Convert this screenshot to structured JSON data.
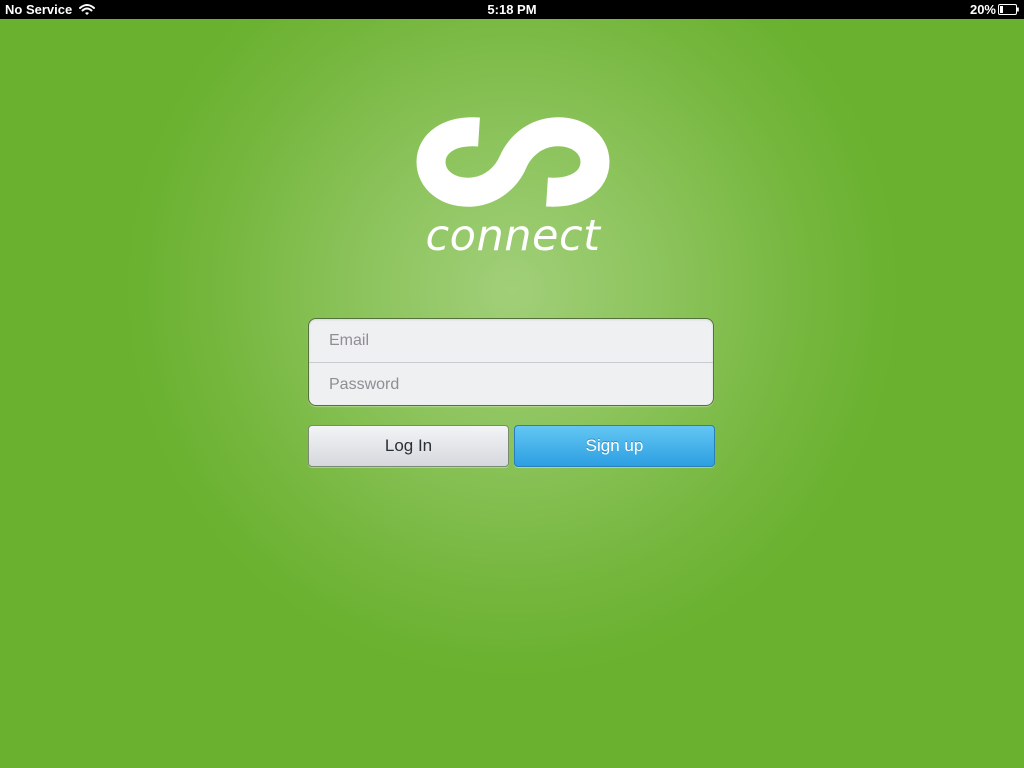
{
  "status_bar": {
    "carrier": "No Service",
    "time": "5:18 PM",
    "battery_percent": "20%",
    "battery_level": 0.2,
    "wifi_icon": "wifi-icon",
    "battery_icon": "battery-icon"
  },
  "logo": {
    "wordmark": "connect",
    "icon": "infinity-icon"
  },
  "login_form": {
    "email_placeholder": "Email",
    "email_value": "",
    "password_placeholder": "Password",
    "password_value": ""
  },
  "buttons": {
    "login_label": "Log In",
    "signup_label": "Sign up"
  },
  "colors": {
    "background_green": "#6ab22f",
    "background_center": "#a1cf79",
    "signup_blue": "#2d9fe2",
    "login_gray": "#d6d8dd"
  }
}
